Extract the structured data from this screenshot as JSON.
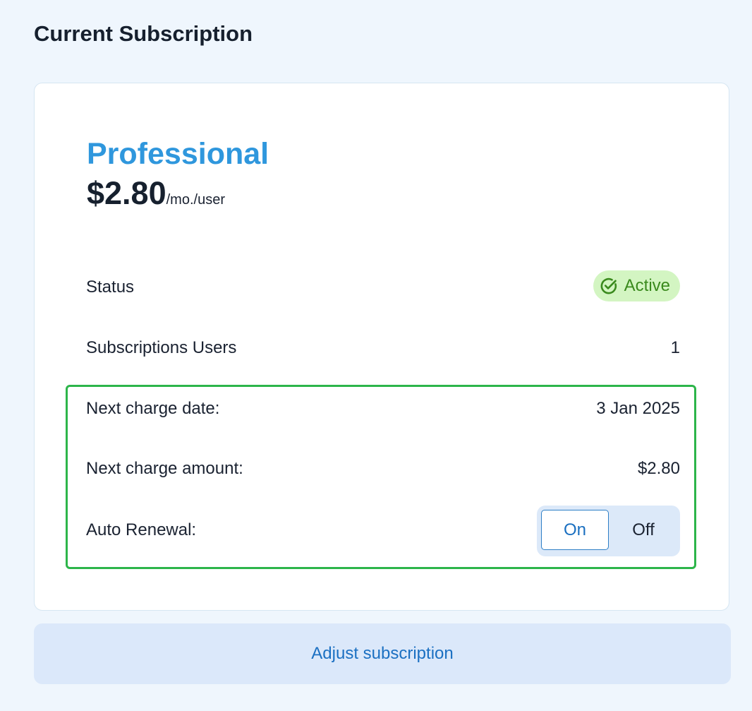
{
  "page": {
    "title": "Current Subscription"
  },
  "plan": {
    "name": "Professional",
    "price": "$2.80",
    "price_unit": "/mo./user"
  },
  "details": {
    "status_label": "Status",
    "status_value": "Active",
    "status_icon": "check-circle-icon",
    "users_label": "Subscriptions Users",
    "users_value": "1",
    "next_charge_date_label": "Next charge date:",
    "next_charge_date_value": "3 Jan 2025",
    "next_charge_amount_label": "Next charge amount:",
    "next_charge_amount_value": "$2.80",
    "auto_renewal_label": "Auto Renewal:",
    "auto_renewal_options": [
      "On",
      "Off"
    ],
    "auto_renewal_selected": "On"
  },
  "actions": {
    "adjust_label": "Adjust subscription"
  },
  "colors": {
    "accent": "#2f97dd",
    "status_bg": "#d3f5c2",
    "status_text": "#3a8a1d",
    "highlight_border": "#2db54a",
    "button_bg": "#dbe8fa",
    "button_text": "#1b70c2"
  }
}
